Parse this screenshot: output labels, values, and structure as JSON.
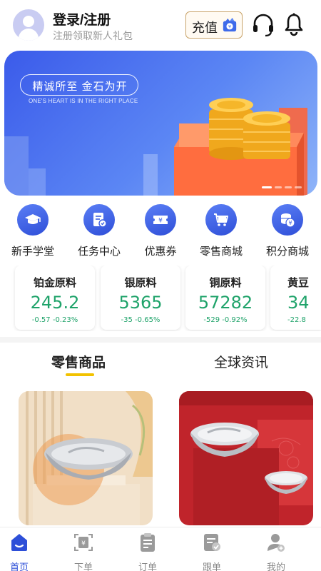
{
  "header": {
    "title": "登录/注册",
    "subtitle": "注册领取新人礼包",
    "recharge_label": "充值",
    "icons": [
      "avatar",
      "recharge-icon",
      "headset-icon",
      "bell-icon"
    ]
  },
  "banner": {
    "slogan": "精诚所至 金石为开",
    "subtitle": "ONE'S HEART IS IN THE RIGHT PLACE",
    "active_slide": 1,
    "slide_count": 4
  },
  "menu": {
    "items": [
      {
        "label": "新手学堂",
        "icon": "graduation-cap-icon"
      },
      {
        "label": "任务中心",
        "icon": "task-document-icon"
      },
      {
        "label": "优惠券",
        "icon": "coupon-icon"
      },
      {
        "label": "零售商城",
        "icon": "shopping-cart-icon"
      },
      {
        "label": "积分商城",
        "icon": "coin-stack-icon"
      }
    ]
  },
  "prices": [
    {
      "name": "铂金原料",
      "value": "245.2",
      "change": "-0.57 -0.23%"
    },
    {
      "name": "银原料",
      "value": "5365",
      "change": "-35 -0.65%"
    },
    {
      "name": "铜原料",
      "value": "57282",
      "change": "-529 -0.92%"
    },
    {
      "name": "黄豆",
      "value": "34",
      "change": "-22.8"
    }
  ],
  "tabs": [
    {
      "label": "零售商品",
      "active": true
    },
    {
      "label": "全球资讯",
      "active": false
    }
  ],
  "colors": {
    "accent": "#2d4fd8",
    "price_green": "#1fa36a",
    "tab_underline": "#f2c200",
    "recharge_border": "#c9a46a"
  },
  "bottom_nav": [
    {
      "label": "首页",
      "icon": "home-icon",
      "active": true
    },
    {
      "label": "下单",
      "icon": "order-scan-icon",
      "active": false
    },
    {
      "label": "订单",
      "icon": "clipboard-icon",
      "active": false
    },
    {
      "label": "跟单",
      "icon": "follow-document-icon",
      "active": false
    },
    {
      "label": "我的",
      "icon": "profile-icon",
      "active": false
    }
  ]
}
